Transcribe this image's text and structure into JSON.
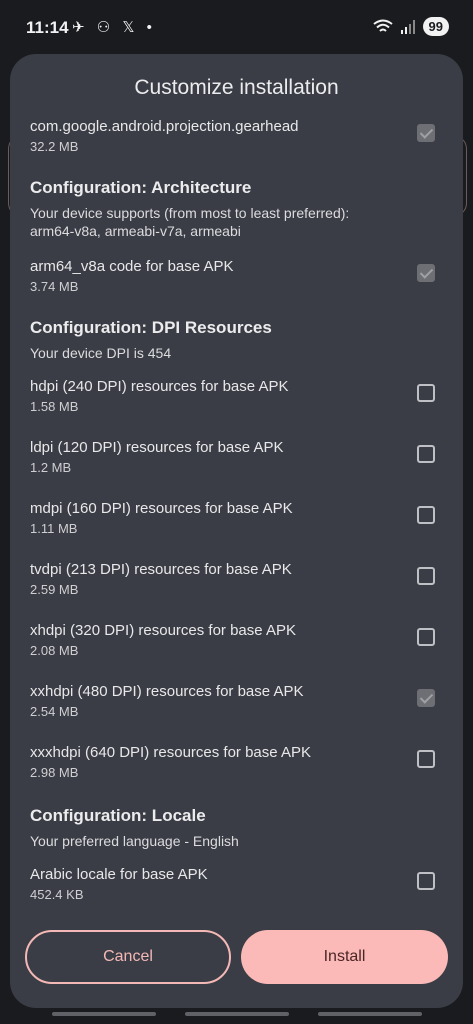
{
  "status_bar": {
    "time": "11:14",
    "left_icons": "✈ ⚇ 𝕏 •",
    "battery": "99"
  },
  "dialog": {
    "title": "Customize installation",
    "top_item": {
      "name": "com.google.android.projection.gearhead",
      "size": "32.2 MB",
      "checked": true
    },
    "architecture": {
      "heading": "Configuration: Architecture",
      "desc_line1": "Your device supports (from most to least preferred):",
      "desc_line2": "arm64-v8a, armeabi-v7a, armeabi",
      "item": {
        "name": "arm64_v8a code for base APK",
        "size": "3.74 MB",
        "checked": true
      }
    },
    "dpi": {
      "heading": "Configuration: DPI Resources",
      "desc": "Your device DPI is 454",
      "items": [
        {
          "name": "hdpi (240 DPI) resources for base APK",
          "size": "1.58 MB",
          "checked": false
        },
        {
          "name": "ldpi (120 DPI) resources for base APK",
          "size": "1.2 MB",
          "checked": false
        },
        {
          "name": "mdpi (160 DPI) resources for base APK",
          "size": "1.11 MB",
          "checked": false
        },
        {
          "name": "tvdpi (213 DPI) resources for base APK",
          "size": "2.59 MB",
          "checked": false
        },
        {
          "name": "xhdpi (320 DPI) resources for base APK",
          "size": "2.08 MB",
          "checked": false
        },
        {
          "name": "xxhdpi (480 DPI) resources for base APK",
          "size": "2.54 MB",
          "checked": true
        },
        {
          "name": "xxxhdpi (640 DPI) resources for base APK",
          "size": "2.98 MB",
          "checked": false
        }
      ]
    },
    "locale": {
      "heading": "Configuration: Locale",
      "desc": "Your preferred language - English",
      "item": {
        "name": "Arabic locale for base APK",
        "size": "452.4 KB",
        "checked": false
      }
    },
    "cancel_label": "Cancel",
    "install_label": "Install"
  },
  "colors": {
    "dialog_bg": "#3a3d45",
    "accent": "#fbb9b7"
  }
}
